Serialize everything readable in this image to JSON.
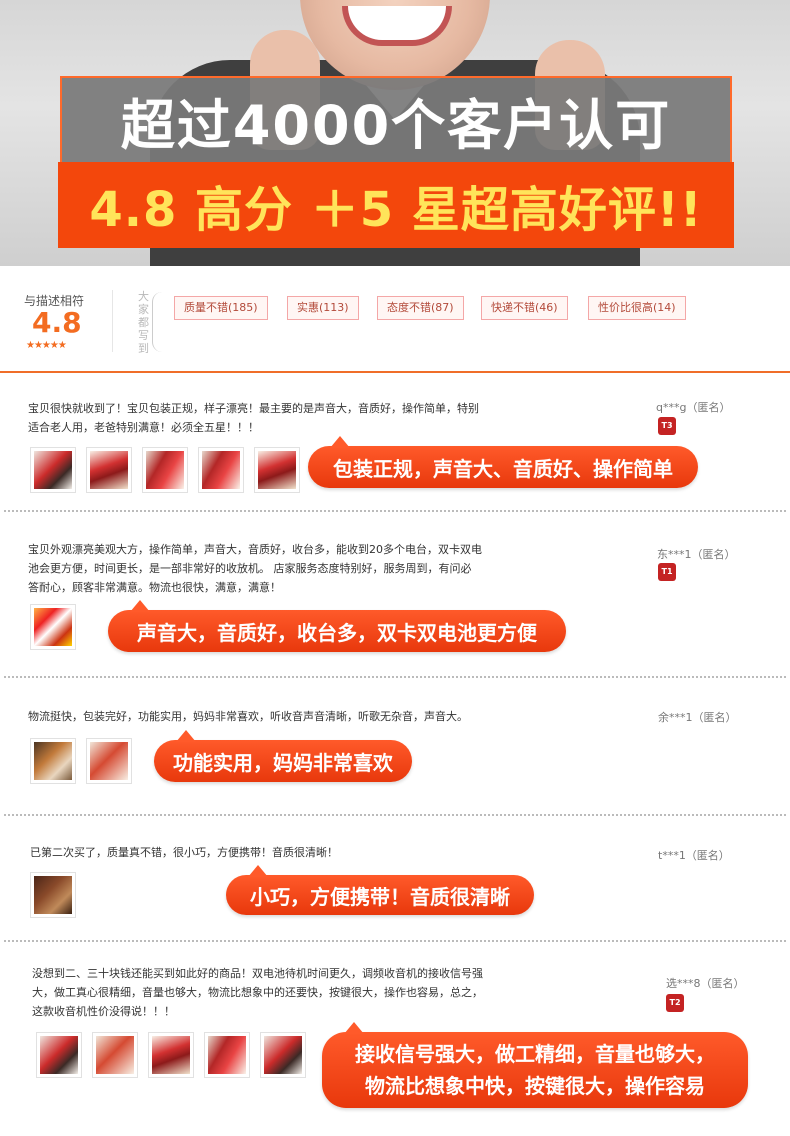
{
  "banner": {
    "headline": "超过4000个客户认可",
    "subline": "4.8 高分 ＋5 星超高好评!!"
  },
  "summary": {
    "score_label": "与描述相符",
    "score": "4.8",
    "stars": "★★★★★",
    "vertical_label": "大家都写到",
    "tags": [
      "质量不错(185)",
      "实惠(113)",
      "态度不错(87)",
      "快递不错(46)",
      "性价比很高(14)"
    ]
  },
  "reviews": [
    {
      "text_lines": [
        "宝贝很快就收到了！宝贝包装正规，样子漂亮！最主要的是声音大，音质好，操作简单，特别",
        "适合老人用，老爸特别满意！必须全五星！！！"
      ],
      "reviewer": "q***g（匿名）",
      "badge": "T3",
      "images": [
        "img-a",
        "img-b",
        "img-c",
        "img-c",
        "img-b"
      ],
      "highlight": "包装正规，声音大、音质好、操作简单"
    },
    {
      "text_lines": [
        "宝贝外观漂亮美观大方，操作简单，声音大，音质好，收台多，能收到20多个电台，双卡双电",
        "池会更方便，时间更长，是一部非常好的收放机。 店家服务态度特别好，服务周到，有问必",
        "答耐心，顾客非常满意。物流也很快，满意，满意！"
      ],
      "reviewer": "东***1（匿名）",
      "badge": "T1",
      "images": [
        "img-d"
      ],
      "highlight": "声音大，音质好，收台多，双卡双电池更方便"
    },
    {
      "text_lines": [
        "物流挺快，包装完好，功能实用，妈妈非常喜欢，听收音声音清晰，听歌无杂音，声音大。"
      ],
      "reviewer": "余***1（匿名）",
      "badge": "",
      "images": [
        "img-e",
        "img-f"
      ],
      "highlight": "功能实用，妈妈非常喜欢"
    },
    {
      "text_lines": [
        "已第二次买了，质量真不错，很小巧，方便携带！音质很清晰！"
      ],
      "reviewer": "t***1（匿名）",
      "badge": "",
      "images": [
        "img-g"
      ],
      "highlight": "小巧，方便携带！音质很清晰"
    },
    {
      "text_lines": [
        "没想到二、三十块钱还能买到如此好的商品！双电池待机时间更久，调频收音机的接收信号强",
        "大，做工真心很精细，音量也够大，物流比想象中的还要快，按键很大，操作也容易，总之，",
        "这款收音机性价没得说！！！"
      ],
      "reviewer": "选***8（匿名）",
      "badge": "T2",
      "images": [
        "img-a",
        "img-f",
        "img-b",
        "img-c",
        "img-a"
      ],
      "highlight_lines": [
        "接收信号强大，做工精细，音量也够大，",
        "物流比想象中快，按键很大，操作容易"
      ]
    }
  ],
  "colors": {
    "accent": "#f3470c",
    "score": "#f36c21",
    "highlight_text": "#ffe45a",
    "badge": "#c42323"
  }
}
